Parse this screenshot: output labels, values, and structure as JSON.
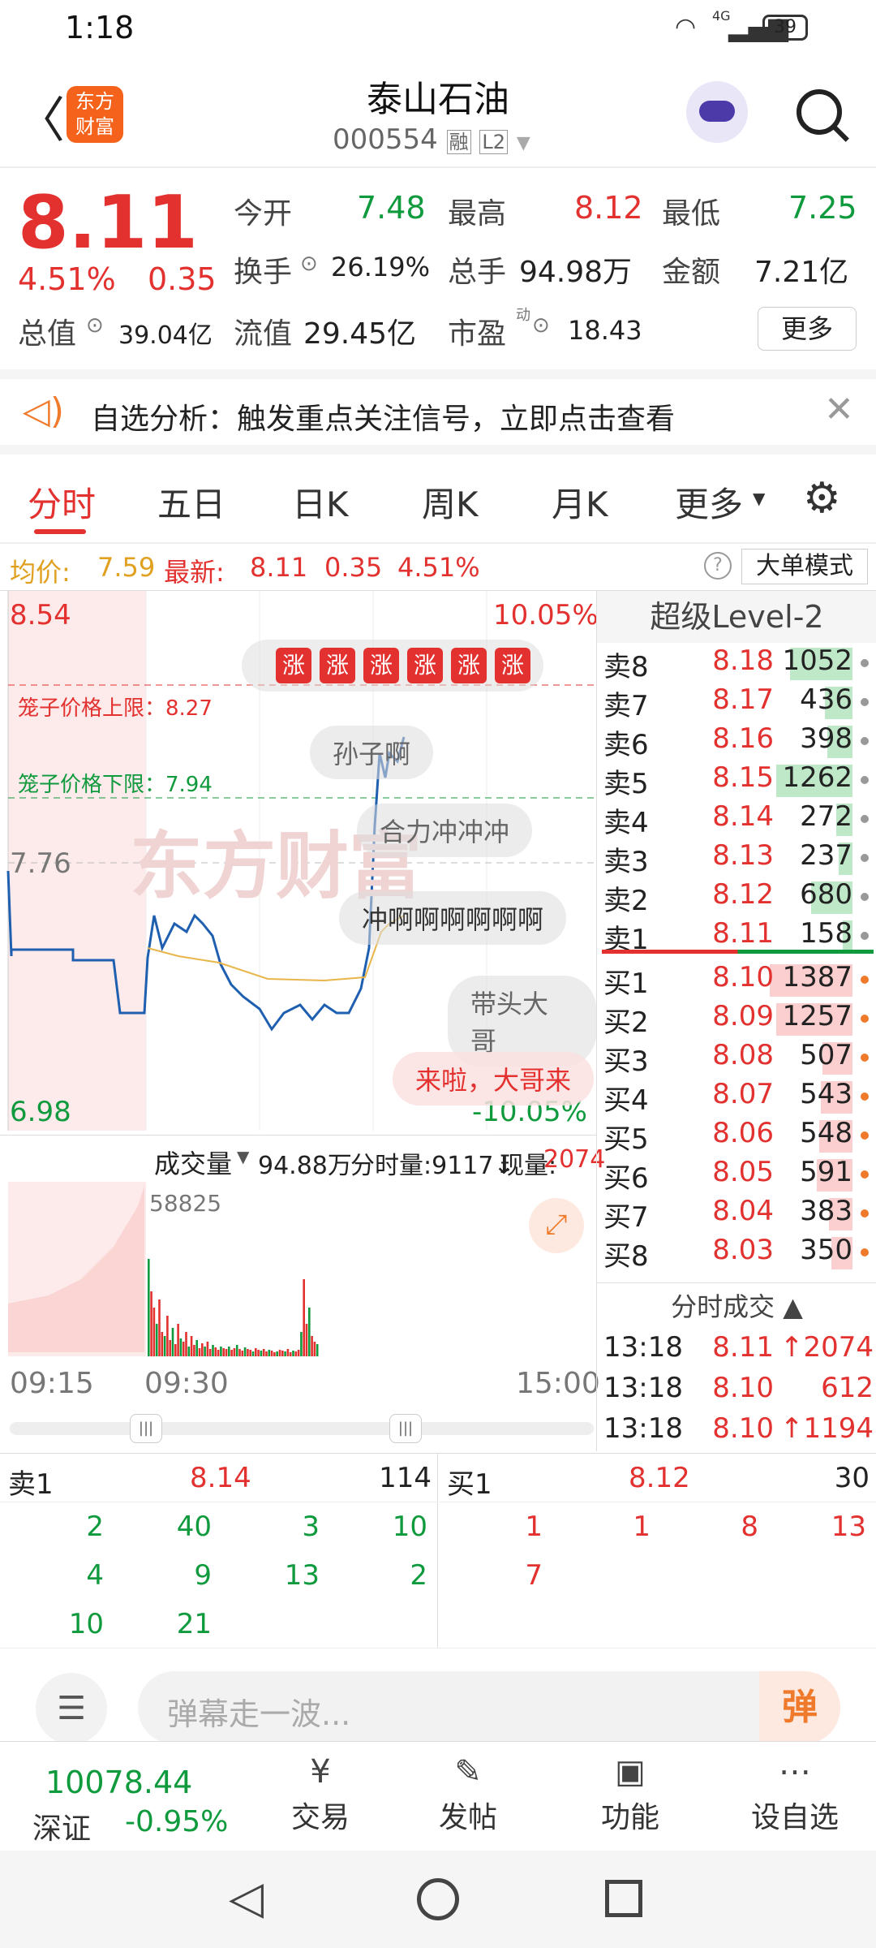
{
  "status": {
    "time": "1:18",
    "battery": "39",
    "network": "4G"
  },
  "header": {
    "title": "泰山石油",
    "code": "000554",
    "tag_rong": "融",
    "tag_l2": "L2",
    "logo_line1": "东方",
    "logo_line2": "财富"
  },
  "quote": {
    "price": "8.11",
    "pct": "4.51%",
    "chg": "0.35",
    "open_label": "今开",
    "open": "7.48",
    "high_label": "最高",
    "high": "8.12",
    "low_label": "最低",
    "low": "7.25",
    "turnover_label": "换手",
    "turnover": "26.19%",
    "volume_label": "总手",
    "volume": "94.98万",
    "amount_label": "金额",
    "amount": "7.21亿",
    "mktcap_label": "总值",
    "mktcap": "39.04亿",
    "float_label": "流值",
    "float": "29.45亿",
    "pe_label": "市盈",
    "pe_sup": "动",
    "pe": "18.43",
    "more": "更多"
  },
  "banner": {
    "text": "自选分析：触发重点关注信号，立即点击查看"
  },
  "tabs": [
    "分时",
    "五日",
    "日K",
    "周K",
    "月K",
    "更多"
  ],
  "infoline": {
    "avg_label": "均价:",
    "avg": "7.59",
    "last_label": "最新:",
    "last": "8.11",
    "chg": "0.35",
    "pct": "4.51%",
    "mode": "大单模式"
  },
  "chart": {
    "ymax": "8.54",
    "ymin": "6.98",
    "ymid": "7.76",
    "pct_top": "10.05%",
    "pct_bottom": "-10.05%",
    "upper_limit": "笼子价格上限：8.27",
    "lower_limit": "笼子价格下限：7.94",
    "zhang": [
      "涨",
      "涨",
      "涨",
      "涨",
      "涨",
      "涨"
    ],
    "bubbles": [
      "孙子啊",
      "合力冲冲冲",
      "冲啊啊啊啊啊啊",
      "带头大哥",
      "来啦，大哥来"
    ],
    "watermark": "东方财富",
    "vol_label": "成交量",
    "vol_total": "94.88万",
    "fen_label": "分时量:9117↓",
    "now_label": "现量:",
    "now_val": "2074",
    "vol_max": "58825",
    "t_start": "09:15",
    "t_open": "09:30",
    "t_end": "15:00"
  },
  "level2": {
    "title": "超级Level-2",
    "asks": [
      {
        "n": "卖8",
        "p": "8.18",
        "v": "1052",
        "w": 0.45
      },
      {
        "n": "卖7",
        "p": "8.17",
        "v": "436",
        "w": 0.2
      },
      {
        "n": "卖6",
        "p": "8.16",
        "v": "398",
        "w": 0.18
      },
      {
        "n": "卖5",
        "p": "8.15",
        "v": "1262",
        "w": 0.55
      },
      {
        "n": "卖4",
        "p": "8.14",
        "v": "272",
        "w": 0.12
      },
      {
        "n": "卖3",
        "p": "8.13",
        "v": "237",
        "w": 0.1
      },
      {
        "n": "卖2",
        "p": "8.12",
        "v": "680",
        "w": 0.3
      },
      {
        "n": "卖1",
        "p": "8.11",
        "v": "158",
        "w": 0.07
      }
    ],
    "bids": [
      {
        "n": "买1",
        "p": "8.10",
        "v": "1387",
        "w": 0.6
      },
      {
        "n": "买2",
        "p": "8.09",
        "v": "1257",
        "w": 0.55
      },
      {
        "n": "买3",
        "p": "8.08",
        "v": "507",
        "w": 0.22
      },
      {
        "n": "买4",
        "p": "8.07",
        "v": "543",
        "w": 0.23
      },
      {
        "n": "买5",
        "p": "8.06",
        "v": "548",
        "w": 0.24
      },
      {
        "n": "买6",
        "p": "8.05",
        "v": "591",
        "w": 0.26
      },
      {
        "n": "买7",
        "p": "8.04",
        "v": "383",
        "w": 0.17
      },
      {
        "n": "买8",
        "p": "8.03",
        "v": "350",
        "w": 0.15
      }
    ],
    "trades_label": "分时成交",
    "trades": [
      {
        "t": "13:18",
        "p": "8.11",
        "v": "↑2074"
      },
      {
        "t": "13:18",
        "p": "8.10",
        "v": "612"
      },
      {
        "t": "13:18",
        "p": "8.10",
        "v": "↑1194"
      }
    ]
  },
  "orderbook": {
    "sell_label": "卖1",
    "sell_price": "8.14",
    "sell_total": "114",
    "buy_label": "买1",
    "buy_price": "8.12",
    "buy_total": "30",
    "sell_rows": [
      [
        "2",
        "40",
        "3",
        "10"
      ],
      [
        "4",
        "9",
        "13",
        "2"
      ],
      [
        "10",
        "21",
        "",
        ""
      ]
    ],
    "buy_rows": [
      [
        "1",
        "1",
        "8",
        "13"
      ],
      [
        "7",
        "",
        "",
        ""
      ]
    ]
  },
  "danmu": {
    "placeholder": "弹幕走一波...",
    "button": "弹"
  },
  "footer": {
    "index_value": "10078.44",
    "index_name": "深证",
    "index_pct": "-0.95%",
    "items": [
      "交易",
      "发帖",
      "功能",
      "设自选"
    ]
  }
}
